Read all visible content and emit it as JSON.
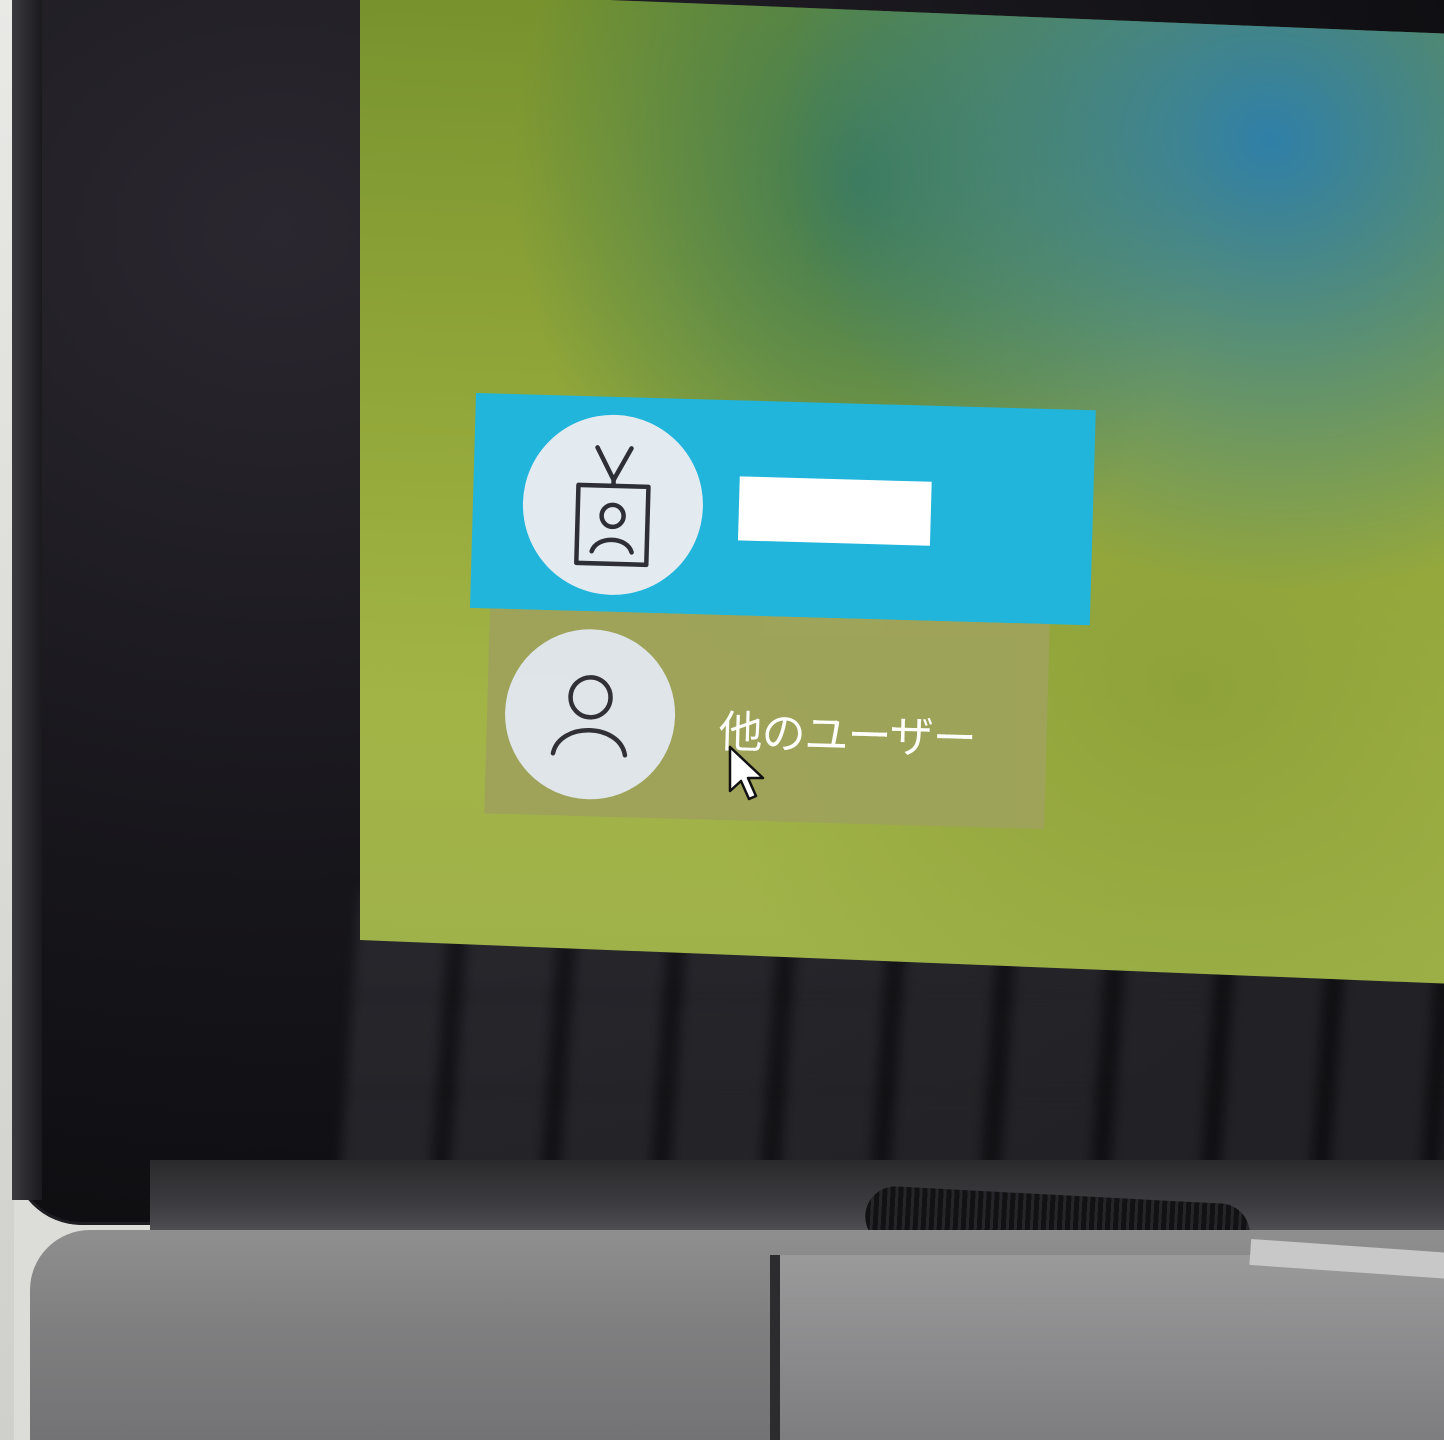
{
  "login": {
    "users": [
      {
        "icon": "id-badge-user-icon",
        "name": "",
        "selected": true,
        "accent": "#22b5dc"
      },
      {
        "icon": "person-outline-icon",
        "name": "他のユーザー",
        "selected": false
      }
    ]
  },
  "colors": {
    "wallpaper": "#8ea23a",
    "selected_tile": "#22b5dc",
    "other_tile": "#9ea35a"
  },
  "pointer": {
    "icon": "mouse-cursor-icon"
  }
}
